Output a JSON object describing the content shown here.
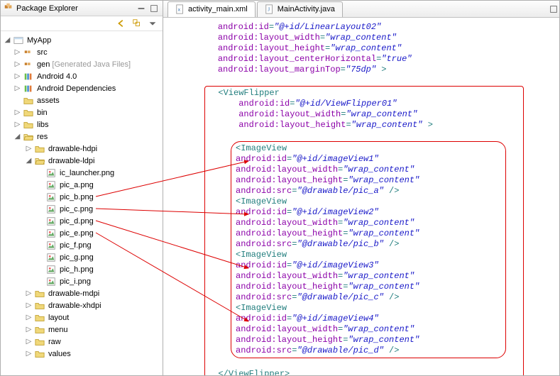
{
  "explorer": {
    "title": "Package Explorer",
    "project": "MyApp",
    "items": {
      "src": "src",
      "gen": "gen",
      "gen_suffix": "[Generated Java Files]",
      "android40": "Android 4.0",
      "dependencies": "Android Dependencies",
      "assets": "assets",
      "bin": "bin",
      "libs": "libs",
      "res": "res",
      "drawable_hdpi": "drawable-hdpi",
      "drawable_ldpi": "drawable-ldpi",
      "ic_launcher": "ic_launcher.png",
      "pic_a": "pic_a.png",
      "pic_b": "pic_b.png",
      "pic_c": "pic_c.png",
      "pic_d": "pic_d.png",
      "pic_e": "pic_e.png",
      "pic_f": "pic_f.png",
      "pic_g": "pic_g.png",
      "pic_h": "pic_h.png",
      "pic_i": "pic_i.png",
      "drawable_mdpi": "drawable-mdpi",
      "drawable_xhdpi": "drawable-xhdpi",
      "layout": "layout",
      "menu": "menu",
      "raw": "raw",
      "values": "values"
    }
  },
  "tabs": {
    "t1": "activity_main.xml",
    "t2": "MainActivity.java"
  },
  "code": {
    "l1a": "android:id",
    "l1v": "\"@+id/LinearLayout02\"",
    "l2a": "android:layout_width",
    "l2v": "\"wrap_content\"",
    "l3a": "android:layout_height",
    "l3v": "\"wrap_content\"",
    "l4a": "android:layout_centerHorizontal",
    "l4v": "\"true\"",
    "l5a": "android:layout_marginTop",
    "l5v": "\"75dp\"",
    "vf": "ViewFlipper",
    "vf_id": "\"@+id/ViewFlipper01\"",
    "wrap": "\"wrap_content\"",
    "iv": "ImageView",
    "iv1": "\"@+id/imageView1\"",
    "iv2": "\"@+id/imageView2\"",
    "iv3": "\"@+id/imageView3\"",
    "iv4": "\"@+id/imageView4\"",
    "src_a": "\"@drawable/pic_a\"",
    "src_b": "\"@drawable/pic_b\"",
    "src_c": "\"@drawable/pic_c\"",
    "src_d": "\"@drawable/pic_d\"",
    "attr_id": "android:id",
    "attr_w": "android:layout_width",
    "attr_h": "android:layout_height",
    "attr_src": "android:src"
  },
  "annotation_colors": {
    "arrow": "#d00000"
  }
}
